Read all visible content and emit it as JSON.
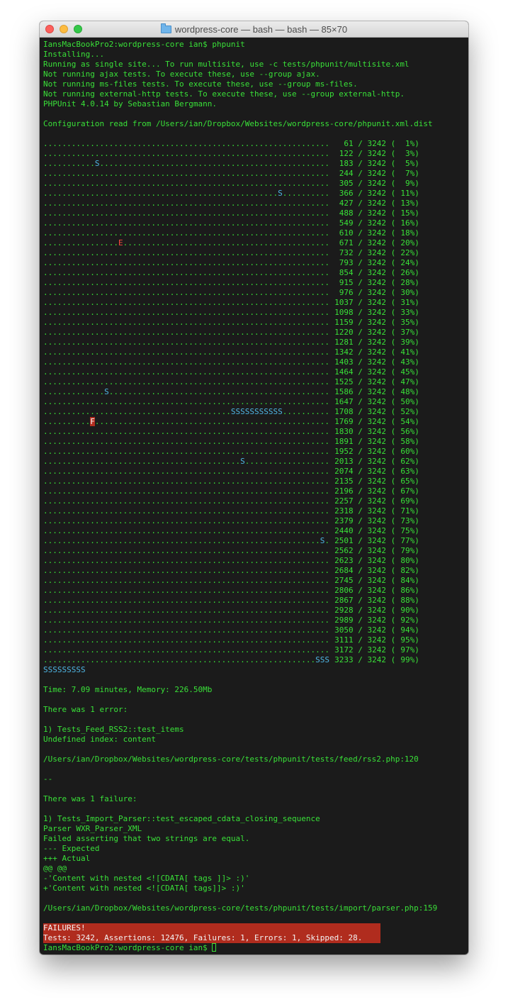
{
  "window": {
    "title": "wordpress-core — bash — bash — 85×70",
    "title_icon": "folder-icon"
  },
  "colors": {
    "background": "#1b1b1b",
    "text": "#39e038",
    "skipped": "#4fb6e4",
    "error": "#ff4b40",
    "failure_bar": "#b02c1e"
  },
  "header_lines": [
    "IansMacBookPro2:wordpress-core ian$ phpunit",
    "Installing...",
    "Running as single site... To run multisite, use -c tests/phpunit/multisite.xml",
    "Not running ajax tests. To execute these, use --group ajax.",
    "Not running ms-files tests. To execute these, use --group ms-files.",
    "Not running external-http tests. To execute these, use --group external-http.",
    "PHPUnit 4.0.14 by Sebastian Bergmann.",
    "",
    "Configuration read from /Users/ian/Dropbox/Websites/wordpress-core/phpunit.xml.dist",
    ""
  ],
  "progress_rows": [
    {
      "marks": ".............................................................",
      "count": "61",
      "total": "3242",
      "percent": "1%"
    },
    {
      "marks": ".............................................................",
      "count": "122",
      "total": "3242",
      "percent": "3%"
    },
    {
      "marks": "...........S.................................................",
      "count": "183",
      "total": "3242",
      "percent": "5%"
    },
    {
      "marks": ".............................................................",
      "count": "244",
      "total": "3242",
      "percent": "7%"
    },
    {
      "marks": ".............................................................",
      "count": "305",
      "total": "3242",
      "percent": "9%"
    },
    {
      "marks": "..................................................S..........",
      "count": "366",
      "total": "3242",
      "percent": "11%"
    },
    {
      "marks": ".............................................................",
      "count": "427",
      "total": "3242",
      "percent": "13%"
    },
    {
      "marks": ".............................................................",
      "count": "488",
      "total": "3242",
      "percent": "15%"
    },
    {
      "marks": ".............................................................",
      "count": "549",
      "total": "3242",
      "percent": "16%"
    },
    {
      "marks": ".............................................................",
      "count": "610",
      "total": "3242",
      "percent": "18%"
    },
    {
      "marks": "................E............................................",
      "count": "671",
      "total": "3242",
      "percent": "20%"
    },
    {
      "marks": ".............................................................",
      "count": "732",
      "total": "3242",
      "percent": "22%"
    },
    {
      "marks": ".............................................................",
      "count": "793",
      "total": "3242",
      "percent": "24%"
    },
    {
      "marks": ".............................................................",
      "count": "854",
      "total": "3242",
      "percent": "26%"
    },
    {
      "marks": ".............................................................",
      "count": "915",
      "total": "3242",
      "percent": "28%"
    },
    {
      "marks": ".............................................................",
      "count": "976",
      "total": "3242",
      "percent": "30%"
    },
    {
      "marks": ".............................................................",
      "count": "1037",
      "total": "3242",
      "percent": "31%"
    },
    {
      "marks": ".............................................................",
      "count": "1098",
      "total": "3242",
      "percent": "33%"
    },
    {
      "marks": ".............................................................",
      "count": "1159",
      "total": "3242",
      "percent": "35%"
    },
    {
      "marks": ".............................................................",
      "count": "1220",
      "total": "3242",
      "percent": "37%"
    },
    {
      "marks": ".............................................................",
      "count": "1281",
      "total": "3242",
      "percent": "39%"
    },
    {
      "marks": ".............................................................",
      "count": "1342",
      "total": "3242",
      "percent": "41%"
    },
    {
      "marks": ".............................................................",
      "count": "1403",
      "total": "3242",
      "percent": "43%"
    },
    {
      "marks": ".............................................................",
      "count": "1464",
      "total": "3242",
      "percent": "45%"
    },
    {
      "marks": ".............................................................",
      "count": "1525",
      "total": "3242",
      "percent": "47%"
    },
    {
      "marks": ".............S...............................................",
      "count": "1586",
      "total": "3242",
      "percent": "48%"
    },
    {
      "marks": ".............................................................",
      "count": "1647",
      "total": "3242",
      "percent": "50%"
    },
    {
      "marks": "........................................SSSSSSSSSSS..........",
      "count": "1708",
      "total": "3242",
      "percent": "52%"
    },
    {
      "marks": "..........F..................................................",
      "count": "1769",
      "total": "3242",
      "percent": "54%"
    },
    {
      "marks": ".............................................................",
      "count": "1830",
      "total": "3242",
      "percent": "56%"
    },
    {
      "marks": ".............................................................",
      "count": "1891",
      "total": "3242",
      "percent": "58%"
    },
    {
      "marks": ".............................................................",
      "count": "1952",
      "total": "3242",
      "percent": "60%"
    },
    {
      "marks": "..........................................S..................",
      "count": "2013",
      "total": "3242",
      "percent": "62%"
    },
    {
      "marks": ".............................................................",
      "count": "2074",
      "total": "3242",
      "percent": "63%"
    },
    {
      "marks": ".............................................................",
      "count": "2135",
      "total": "3242",
      "percent": "65%"
    },
    {
      "marks": ".............................................................",
      "count": "2196",
      "total": "3242",
      "percent": "67%"
    },
    {
      "marks": ".............................................................",
      "count": "2257",
      "total": "3242",
      "percent": "69%"
    },
    {
      "marks": ".............................................................",
      "count": "2318",
      "total": "3242",
      "percent": "71%"
    },
    {
      "marks": ".............................................................",
      "count": "2379",
      "total": "3242",
      "percent": "73%"
    },
    {
      "marks": ".............................................................",
      "count": "2440",
      "total": "3242",
      "percent": "75%"
    },
    {
      "marks": "...........................................................S.",
      "count": "2501",
      "total": "3242",
      "percent": "77%"
    },
    {
      "marks": ".............................................................",
      "count": "2562",
      "total": "3242",
      "percent": "79%"
    },
    {
      "marks": ".............................................................",
      "count": "2623",
      "total": "3242",
      "percent": "80%"
    },
    {
      "marks": ".............................................................",
      "count": "2684",
      "total": "3242",
      "percent": "82%"
    },
    {
      "marks": ".............................................................",
      "count": "2745",
      "total": "3242",
      "percent": "84%"
    },
    {
      "marks": ".............................................................",
      "count": "2806",
      "total": "3242",
      "percent": "86%"
    },
    {
      "marks": ".............................................................",
      "count": "2867",
      "total": "3242",
      "percent": "88%"
    },
    {
      "marks": ".............................................................",
      "count": "2928",
      "total": "3242",
      "percent": "90%"
    },
    {
      "marks": ".............................................................",
      "count": "2989",
      "total": "3242",
      "percent": "92%"
    },
    {
      "marks": ".............................................................",
      "count": "3050",
      "total": "3242",
      "percent": "94%"
    },
    {
      "marks": ".............................................................",
      "count": "3111",
      "total": "3242",
      "percent": "95%"
    },
    {
      "marks": ".............................................................",
      "count": "3172",
      "total": "3242",
      "percent": "97%"
    },
    {
      "marks": "..........................................................SSS",
      "count": "3233",
      "total": "3242",
      "percent": "99%"
    }
  ],
  "trailing_skips": "SSSSSSSSS",
  "footer_lines": [
    "",
    "Time: 7.09 minutes, Memory: 226.50Mb",
    "",
    "There was 1 error:",
    "",
    "1) Tests_Feed_RSS2::test_items",
    "Undefined index: content",
    "",
    "/Users/ian/Dropbox/Websites/wordpress-core/tests/phpunit/tests/feed/rss2.php:120",
    "",
    "--",
    "",
    "There was 1 failure:",
    "",
    "1) Tests_Import_Parser::test_escaped_cdata_closing_sequence",
    "Parser WXR_Parser_XML",
    "Failed asserting that two strings are equal.",
    "--- Expected",
    "+++ Actual",
    "@@ @@",
    "-'Content with nested <![CDATA[ tags ]]> :)'",
    "+'Content with nested <![CDATA[ tags]]> :)'",
    "",
    "/Users/ian/Dropbox/Websites/wordpress-core/tests/phpunit/tests/import/parser.php:159",
    ""
  ],
  "summary": {
    "status": "FAILURES!",
    "counts": "Tests: 3242, Assertions: 12476, Failures: 1, Errors: 1, Skipped: 28."
  },
  "prompt": "IansMacBookPro2:wordpress-core ian$ "
}
